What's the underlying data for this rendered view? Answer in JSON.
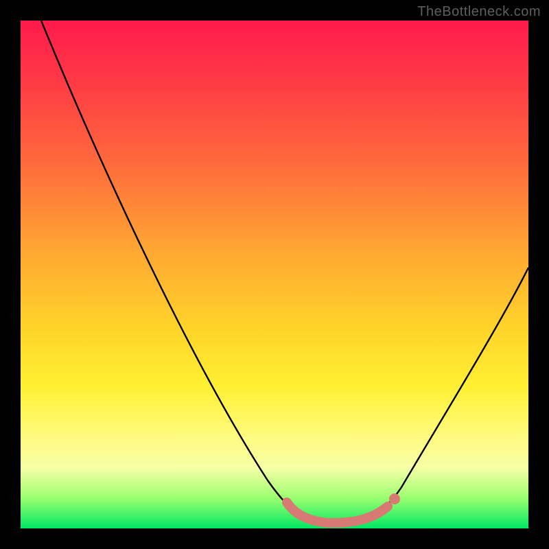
{
  "watermark": "TheBottleneck.com",
  "colors": {
    "frame": "#000000",
    "gradient_top": "#ff1a4c",
    "gradient_mid": "#ffd22a",
    "gradient_bottom": "#00e862",
    "curve": "#000000",
    "highlight": "#d87a74"
  },
  "chart_data": {
    "type": "line",
    "title": "",
    "xlabel": "",
    "ylabel": "",
    "xlim": [
      0,
      100
    ],
    "ylim": [
      0,
      100
    ],
    "series": [
      {
        "name": "curve",
        "x": [
          4,
          10,
          18,
          26,
          34,
          42,
          47,
          51,
          55,
          59,
          63,
          67,
          71,
          76,
          82,
          88,
          94,
          100
        ],
        "y": [
          100,
          88,
          74,
          60,
          46,
          32,
          22,
          14,
          8,
          4,
          3,
          3,
          4,
          9,
          18,
          30,
          42,
          56
        ]
      }
    ],
    "annotations": [
      {
        "name": "highlight-segment",
        "x": [
          51,
          55,
          59,
          63,
          67,
          71
        ],
        "y": [
          14,
          8,
          4,
          3,
          3,
          4
        ]
      }
    ]
  }
}
